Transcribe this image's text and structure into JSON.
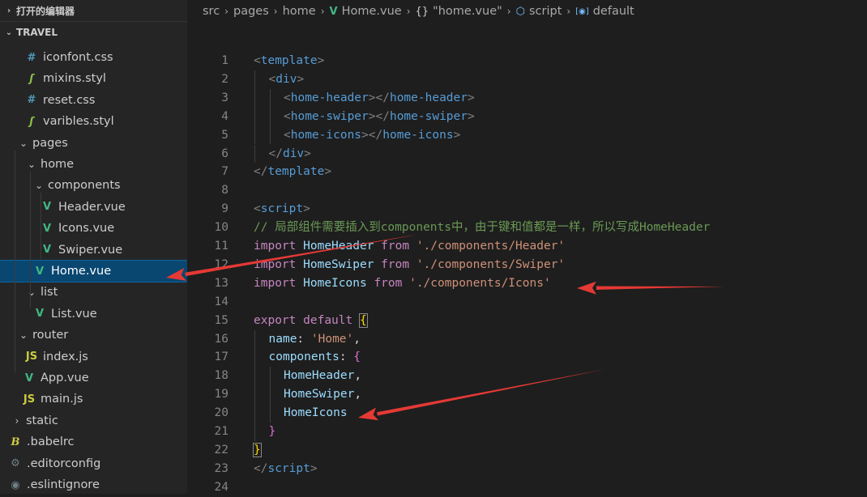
{
  "sidebar": {
    "open_editors_label": "打开的编辑器",
    "project_label": "TRAVEL",
    "items": [
      {
        "label": "iconfont.css",
        "icon": "css-file-icon",
        "glyph": "#",
        "cls": "ic-css",
        "indent": 1,
        "twisty": ""
      },
      {
        "label": "mixins.styl",
        "icon": "stylus-file-icon",
        "glyph": "ʃ",
        "cls": "ic-styl",
        "indent": 1,
        "twisty": ""
      },
      {
        "label": "reset.css",
        "icon": "css-file-icon",
        "glyph": "#",
        "cls": "ic-css",
        "indent": 1,
        "twisty": ""
      },
      {
        "label": "varibles.styl",
        "icon": "stylus-file-icon",
        "glyph": "ʃ",
        "cls": "ic-styl",
        "indent": 1,
        "twisty": ""
      },
      {
        "label": "pages",
        "icon": "folder-open-chevron-icon",
        "glyph": "",
        "cls": "",
        "indent": 0,
        "twisty": "⌄"
      },
      {
        "label": "home",
        "icon": "folder-open-chevron-icon",
        "glyph": "",
        "cls": "",
        "indent": 1,
        "twisty": "⌄"
      },
      {
        "label": "components",
        "icon": "folder-open-chevron-icon",
        "glyph": "",
        "cls": "",
        "indent": 2,
        "twisty": "⌄"
      },
      {
        "label": "Header.vue",
        "icon": "vue-file-icon",
        "glyph": "V",
        "cls": "ic-vue",
        "indent": 3,
        "twisty": ""
      },
      {
        "label": "Icons.vue",
        "icon": "vue-file-icon",
        "glyph": "V",
        "cls": "ic-vue",
        "indent": 3,
        "twisty": ""
      },
      {
        "label": "Swiper.vue",
        "icon": "vue-file-icon",
        "glyph": "V",
        "cls": "ic-vue",
        "indent": 3,
        "twisty": ""
      },
      {
        "label": "Home.vue",
        "icon": "vue-file-icon",
        "glyph": "V",
        "cls": "ic-vue",
        "indent": 2,
        "twisty": "",
        "selected": true
      },
      {
        "label": "list",
        "icon": "folder-open-chevron-icon",
        "glyph": "",
        "cls": "",
        "indent": 1,
        "twisty": "⌄"
      },
      {
        "label": "List.vue",
        "icon": "vue-file-icon",
        "glyph": "V",
        "cls": "ic-vue",
        "indent": 2,
        "twisty": ""
      },
      {
        "label": "router",
        "icon": "folder-open-chevron-icon",
        "glyph": "",
        "cls": "",
        "indent": 0,
        "twisty": "⌄"
      },
      {
        "label": "index.js",
        "icon": "js-file-icon",
        "glyph": "JS",
        "cls": "ic-js",
        "indent": 1,
        "twisty": ""
      },
      {
        "label": "App.vue",
        "icon": "vue-file-icon",
        "glyph": "V",
        "cls": "ic-vue",
        "indent": 0,
        "twisty": ""
      },
      {
        "label": "main.js",
        "icon": "js-file-icon",
        "glyph": "JS",
        "cls": "ic-js",
        "indent": 0,
        "twisty": ""
      },
      {
        "label": "static",
        "icon": "folder-closed-chevron-icon",
        "glyph": "",
        "cls": "",
        "indent": -1,
        "twisty": "›"
      },
      {
        "label": ".babelrc",
        "icon": "babel-file-icon",
        "glyph": "B",
        "cls": "ic-babel",
        "indent": -1,
        "twisty": ""
      },
      {
        "label": ".editorconfig",
        "icon": "gear-icon",
        "glyph": "⚙",
        "cls": "ic-gear",
        "indent": -1,
        "twisty": ""
      },
      {
        "label": ".eslintignore",
        "icon": "eslint-file-icon",
        "glyph": "◉",
        "cls": "ic-eslint",
        "indent": -1,
        "twisty": ""
      }
    ]
  },
  "breadcrumb": [
    {
      "label": "src",
      "icon": ""
    },
    {
      "label": "pages",
      "icon": ""
    },
    {
      "label": "home",
      "icon": ""
    },
    {
      "label": "Home.vue",
      "icon": "vue-file-icon"
    },
    {
      "label": "\"home.vue\"",
      "icon": "braces-icon"
    },
    {
      "label": "script",
      "icon": "cube-icon"
    },
    {
      "label": "default",
      "icon": "field-icon"
    }
  ],
  "code": [
    {
      "n": "1",
      "indent": 0,
      "tokens": [
        [
          "t-tag",
          "<"
        ],
        [
          "t-name",
          "template"
        ],
        [
          "t-tag",
          ">"
        ]
      ]
    },
    {
      "n": "2",
      "indent": 1,
      "tokens": [
        [
          "t-tag",
          "<"
        ],
        [
          "t-name",
          "div"
        ],
        [
          "t-tag",
          ">"
        ]
      ]
    },
    {
      "n": "3",
      "indent": 2,
      "tokens": [
        [
          "t-tag",
          "<"
        ],
        [
          "t-name",
          "home-header"
        ],
        [
          "t-tag",
          "></"
        ],
        [
          "t-name",
          "home-header"
        ],
        [
          "t-tag",
          ">"
        ]
      ]
    },
    {
      "n": "4",
      "indent": 2,
      "tokens": [
        [
          "t-tag",
          "<"
        ],
        [
          "t-name",
          "home-swiper"
        ],
        [
          "t-tag",
          "></"
        ],
        [
          "t-name",
          "home-swiper"
        ],
        [
          "t-tag",
          ">"
        ]
      ]
    },
    {
      "n": "5",
      "indent": 2,
      "tokens": [
        [
          "t-tag",
          "<"
        ],
        [
          "t-name",
          "home-icons"
        ],
        [
          "t-tag",
          "></"
        ],
        [
          "t-name",
          "home-icons"
        ],
        [
          "t-tag",
          ">"
        ]
      ]
    },
    {
      "n": "6",
      "indent": 1,
      "tokens": [
        [
          "t-tag",
          "</"
        ],
        [
          "t-name",
          "div"
        ],
        [
          "t-tag",
          ">"
        ]
      ]
    },
    {
      "n": "7",
      "indent": 0,
      "tokens": [
        [
          "t-tag",
          "</"
        ],
        [
          "t-name",
          "template"
        ],
        [
          "t-tag",
          ">"
        ]
      ]
    },
    {
      "n": "8",
      "indent": 0,
      "tokens": []
    },
    {
      "n": "9",
      "indent": 0,
      "tokens": [
        [
          "t-tag",
          "<"
        ],
        [
          "t-name",
          "script"
        ],
        [
          "t-tag",
          ">"
        ]
      ]
    },
    {
      "n": "10",
      "indent": 0,
      "tokens": [
        [
          "t-comment",
          "// 局部组件需要插入到components中，由于键和值都是一样，所以写成HomeHeader"
        ]
      ]
    },
    {
      "n": "11",
      "indent": 0,
      "tokens": [
        [
          "t-kw",
          "import"
        ],
        [
          "t-plain",
          " "
        ],
        [
          "t-id",
          "HomeHeader"
        ],
        [
          "t-plain",
          " "
        ],
        [
          "t-kw",
          "from"
        ],
        [
          "t-plain",
          " "
        ],
        [
          "t-str",
          "'./components/Header'"
        ]
      ]
    },
    {
      "n": "12",
      "indent": 0,
      "tokens": [
        [
          "t-kw",
          "import"
        ],
        [
          "t-plain",
          " "
        ],
        [
          "t-id",
          "HomeSwiper"
        ],
        [
          "t-plain",
          " "
        ],
        [
          "t-kw",
          "from"
        ],
        [
          "t-plain",
          " "
        ],
        [
          "t-str",
          "'./components/Swiper'"
        ]
      ]
    },
    {
      "n": "13",
      "indent": 0,
      "tokens": [
        [
          "t-kw",
          "import"
        ],
        [
          "t-plain",
          " "
        ],
        [
          "t-id",
          "HomeIcons"
        ],
        [
          "t-plain",
          " "
        ],
        [
          "t-kw",
          "from"
        ],
        [
          "t-plain",
          " "
        ],
        [
          "t-str",
          "'./components/Icons'"
        ]
      ]
    },
    {
      "n": "14",
      "indent": 0,
      "tokens": []
    },
    {
      "n": "15",
      "indent": 0,
      "tokens": [
        [
          "t-kw",
          "export"
        ],
        [
          "t-plain",
          " "
        ],
        [
          "t-kw",
          "default"
        ],
        [
          "t-plain",
          " "
        ],
        [
          "t-brace1 bracket-box",
          "{"
        ]
      ]
    },
    {
      "n": "16",
      "indent": 1,
      "tokens": [
        [
          "t-id",
          "name"
        ],
        [
          "t-plain",
          ": "
        ],
        [
          "t-str",
          "'Home'"
        ],
        [
          "t-plain",
          ","
        ]
      ]
    },
    {
      "n": "17",
      "indent": 1,
      "tokens": [
        [
          "t-id",
          "components"
        ],
        [
          "t-plain",
          ": "
        ],
        [
          "t-brace2",
          "{"
        ]
      ]
    },
    {
      "n": "18",
      "indent": 2,
      "tokens": [
        [
          "t-id",
          "HomeHeader"
        ],
        [
          "t-plain",
          ","
        ]
      ]
    },
    {
      "n": "19",
      "indent": 2,
      "tokens": [
        [
          "t-id",
          "HomeSwiper"
        ],
        [
          "t-plain",
          ","
        ]
      ]
    },
    {
      "n": "20",
      "indent": 2,
      "tokens": [
        [
          "t-id",
          "HomeIcons"
        ]
      ]
    },
    {
      "n": "21",
      "indent": 1,
      "tokens": [
        [
          "t-brace2",
          "}"
        ]
      ]
    },
    {
      "n": "22",
      "indent": 0,
      "tokens": [
        [
          "t-brace1 bracket-box",
          "}"
        ]
      ]
    },
    {
      "n": "23",
      "indent": 0,
      "tokens": [
        [
          "t-tag",
          "</"
        ],
        [
          "t-name",
          "script"
        ],
        [
          "t-tag",
          ">"
        ]
      ]
    },
    {
      "n": "24",
      "indent": 0,
      "tokens": []
    }
  ],
  "annotation_color": "#e53935"
}
